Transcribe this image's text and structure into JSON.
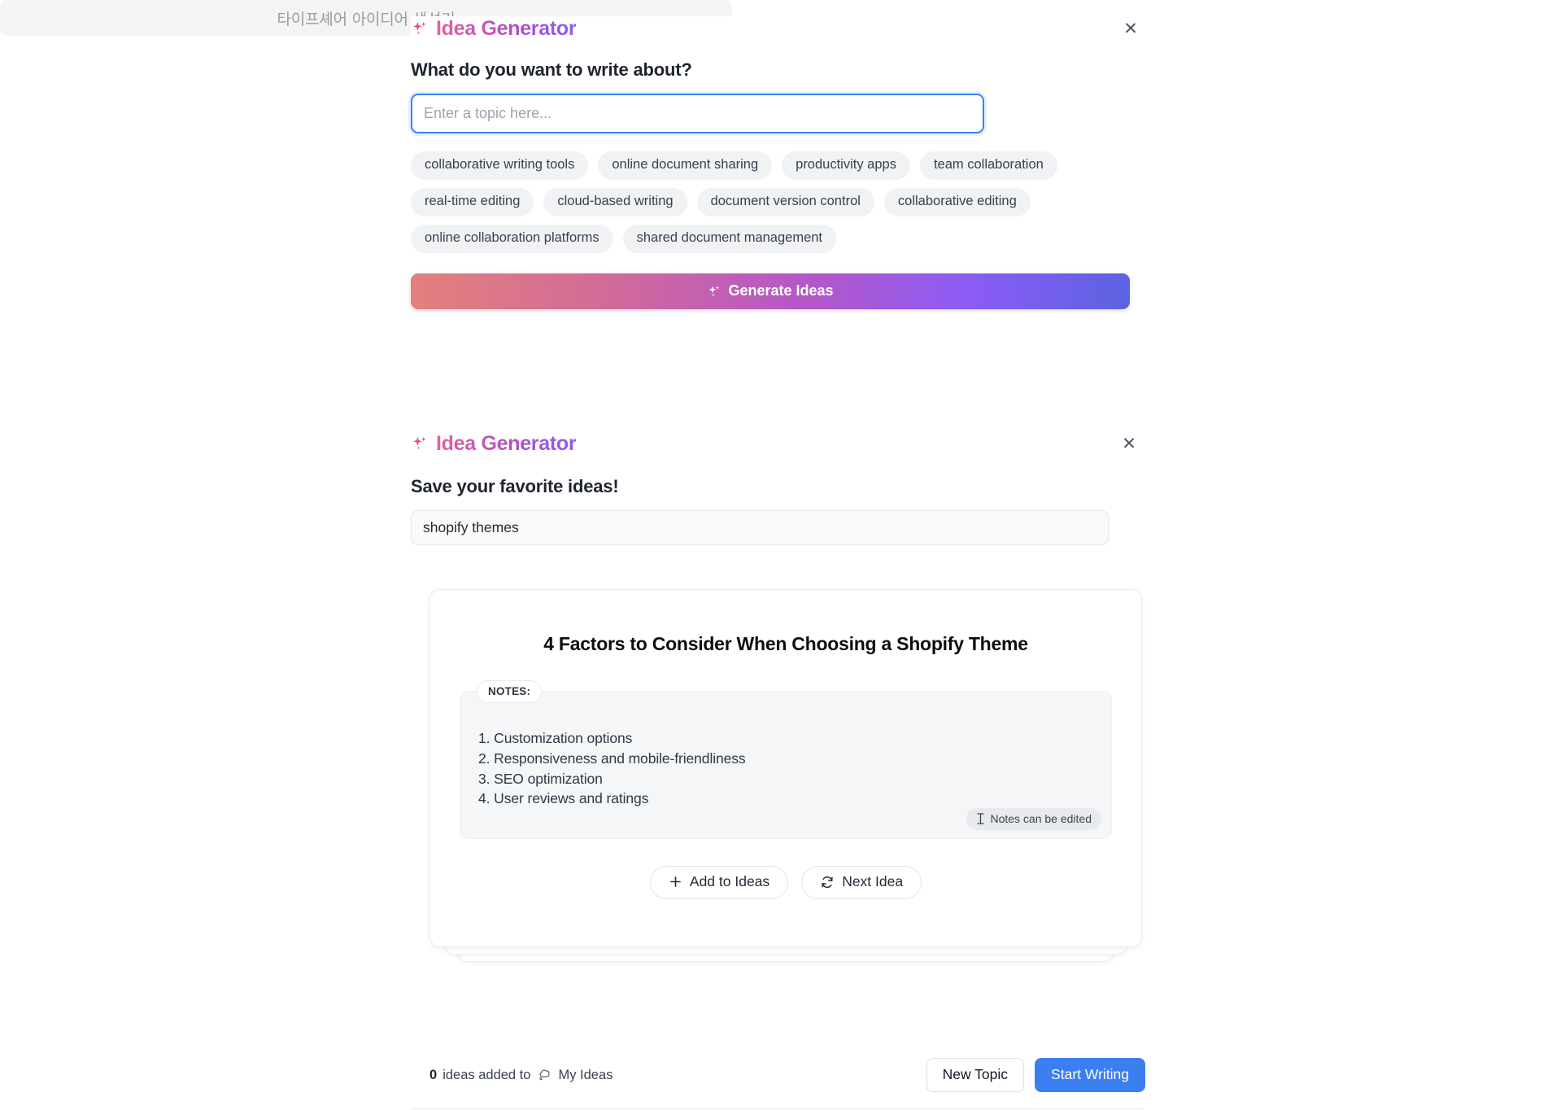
{
  "panel_one": {
    "brand_title": "Idea Generator",
    "brand_icon": "sparkles-icon",
    "close_label": "✕",
    "question_label": "What do you want to write about?",
    "topic_input": {
      "value": "",
      "placeholder": "Enter a topic here..."
    },
    "suggestion_chips": [
      "collaborative writing tools",
      "online document sharing",
      "productivity apps",
      "team collaboration",
      "real-time editing",
      "cloud-based writing",
      "document version control",
      "collaborative editing",
      "online collaboration platforms",
      "shared document management"
    ],
    "generate_button": {
      "label": "Generate Ideas",
      "icon": "sparkles-icon"
    }
  },
  "banner": {
    "text": "타이프셰어 아이디어 생성기"
  },
  "panel_two": {
    "brand_title": "Idea Generator",
    "brand_icon": "sparkles-icon",
    "close_label": "✕",
    "save_label": "Save your favorite ideas!",
    "topic_value": "shopify themes",
    "idea_card": {
      "title": "4 Factors to Consider When Choosing a Shopify Theme",
      "notes_badge": "NOTES:",
      "notes": [
        "1. Customization options",
        "2. Responsiveness and mobile-friendliness",
        "3. SEO optimization",
        "4. User reviews and ratings"
      ],
      "edit_hint": "Notes can be edited",
      "edit_hint_icon": "text-cursor-icon",
      "actions": [
        {
          "label": "Add to Ideas",
          "icon": "plus-icon"
        },
        {
          "label": "Next Idea",
          "icon": "refresh-icon"
        }
      ]
    }
  },
  "footer": {
    "count": "0",
    "count_text": "ideas added to",
    "my_ideas_label": "My Ideas",
    "my_ideas_icon": "thought-bubble-icon",
    "new_topic_label": "New Topic",
    "start_writing_label": "Start Writing"
  },
  "colors": {
    "brand_gradient_start": "#e1629b",
    "brand_gradient_end": "#8b5cf6",
    "primary_blue": "#3b7ef0",
    "input_focus_blue": "#3b82f6",
    "chip_bg": "#f1f2f4",
    "banner_bg": "#f4f4f5",
    "notes_bg": "#f5f6f8"
  }
}
